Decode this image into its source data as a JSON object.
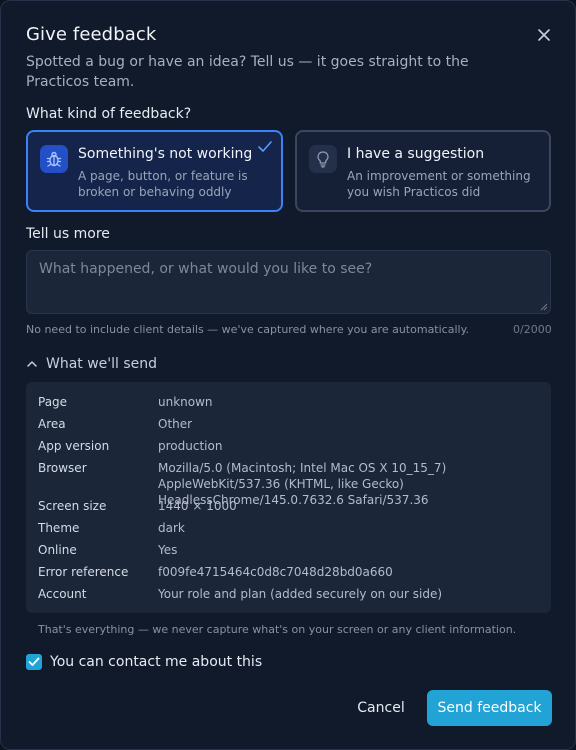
{
  "dialog": {
    "title": "Give feedback",
    "subtitle": "Spotted a bug or have an idea? Tell us — it goes straight to the Practicos team.",
    "close_icon": "close-icon"
  },
  "feedback_type": {
    "label": "What kind of feedback?",
    "options": [
      {
        "title": "Something's not working",
        "desc": "A page, button, or feature is broken or behaving oddly",
        "icon": "bug-icon",
        "selected": true
      },
      {
        "title": "I have a suggestion",
        "desc": "An improvement or something you wish Practicos did",
        "icon": "lightbulb-icon",
        "selected": false
      }
    ]
  },
  "tell_more": {
    "label": "Tell us more",
    "placeholder": "What happened, or what would you like to see?",
    "value": "",
    "hint": "No need to include client details — we've captured where you are automatically.",
    "counter": "0/2000"
  },
  "details": {
    "toggle_label": "What we'll send",
    "expanded": true,
    "rows": [
      {
        "key": "Page",
        "value": "unknown"
      },
      {
        "key": "Area",
        "value": "Other"
      },
      {
        "key": "App version",
        "value": "production"
      },
      {
        "key": "Browser",
        "value": "Mozilla/5.0 (Macintosh; Intel Mac OS X 10_15_7) AppleWebKit/537.36 (KHTML, like Gecko) HeadlessChrome/145.0.7632.6 Safari/537.36"
      },
      {
        "key": "Screen size",
        "value": "1440 × 1000"
      },
      {
        "key": "Theme",
        "value": "dark"
      },
      {
        "key": "Online",
        "value": "Yes"
      },
      {
        "key": "Error reference",
        "value": "f009fe4715464c0d8c7048d28bd0a660"
      },
      {
        "key": "Account",
        "value": "Your role and plan (added securely on our side)"
      }
    ],
    "footnote": "That's everything — we never capture what's on your screen or any client information."
  },
  "contact": {
    "label": "You can contact me about this",
    "checked": true
  },
  "actions": {
    "cancel_label": "Cancel",
    "send_label": "Send feedback"
  },
  "colors": {
    "accent": "#22a3d6",
    "selected_border": "#3b82f6",
    "background": "#111a2b"
  }
}
